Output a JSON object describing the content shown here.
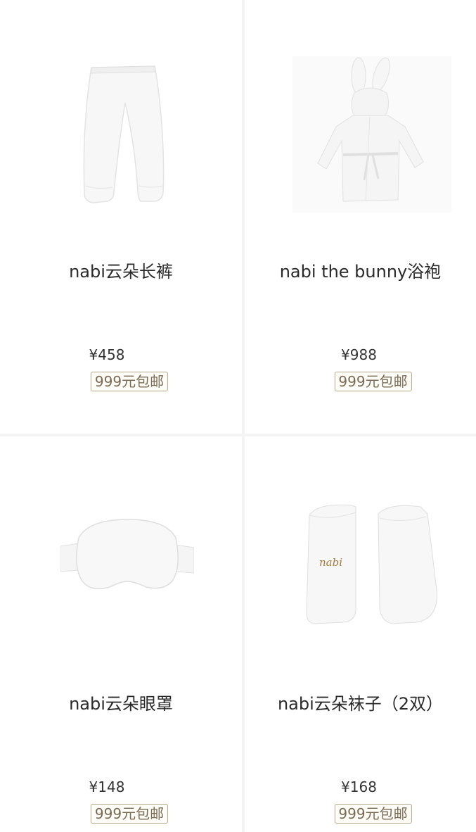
{
  "products": [
    {
      "name": "nabi云朵长裤",
      "price": "¥458",
      "badge": "999元包邮",
      "image": "white-pants"
    },
    {
      "name": "nabi the bunny浴袍",
      "price": "¥988",
      "badge": "999元包邮",
      "image": "bunny-bathrobe"
    },
    {
      "name": "nabi云朵眼罩",
      "price": "¥148",
      "badge": "999元包邮",
      "image": "eye-mask"
    },
    {
      "name": "nabi云朵袜子（2双）",
      "price": "¥168",
      "badge": "999元包邮",
      "image": "socks"
    }
  ],
  "sock_logo": "nabi"
}
